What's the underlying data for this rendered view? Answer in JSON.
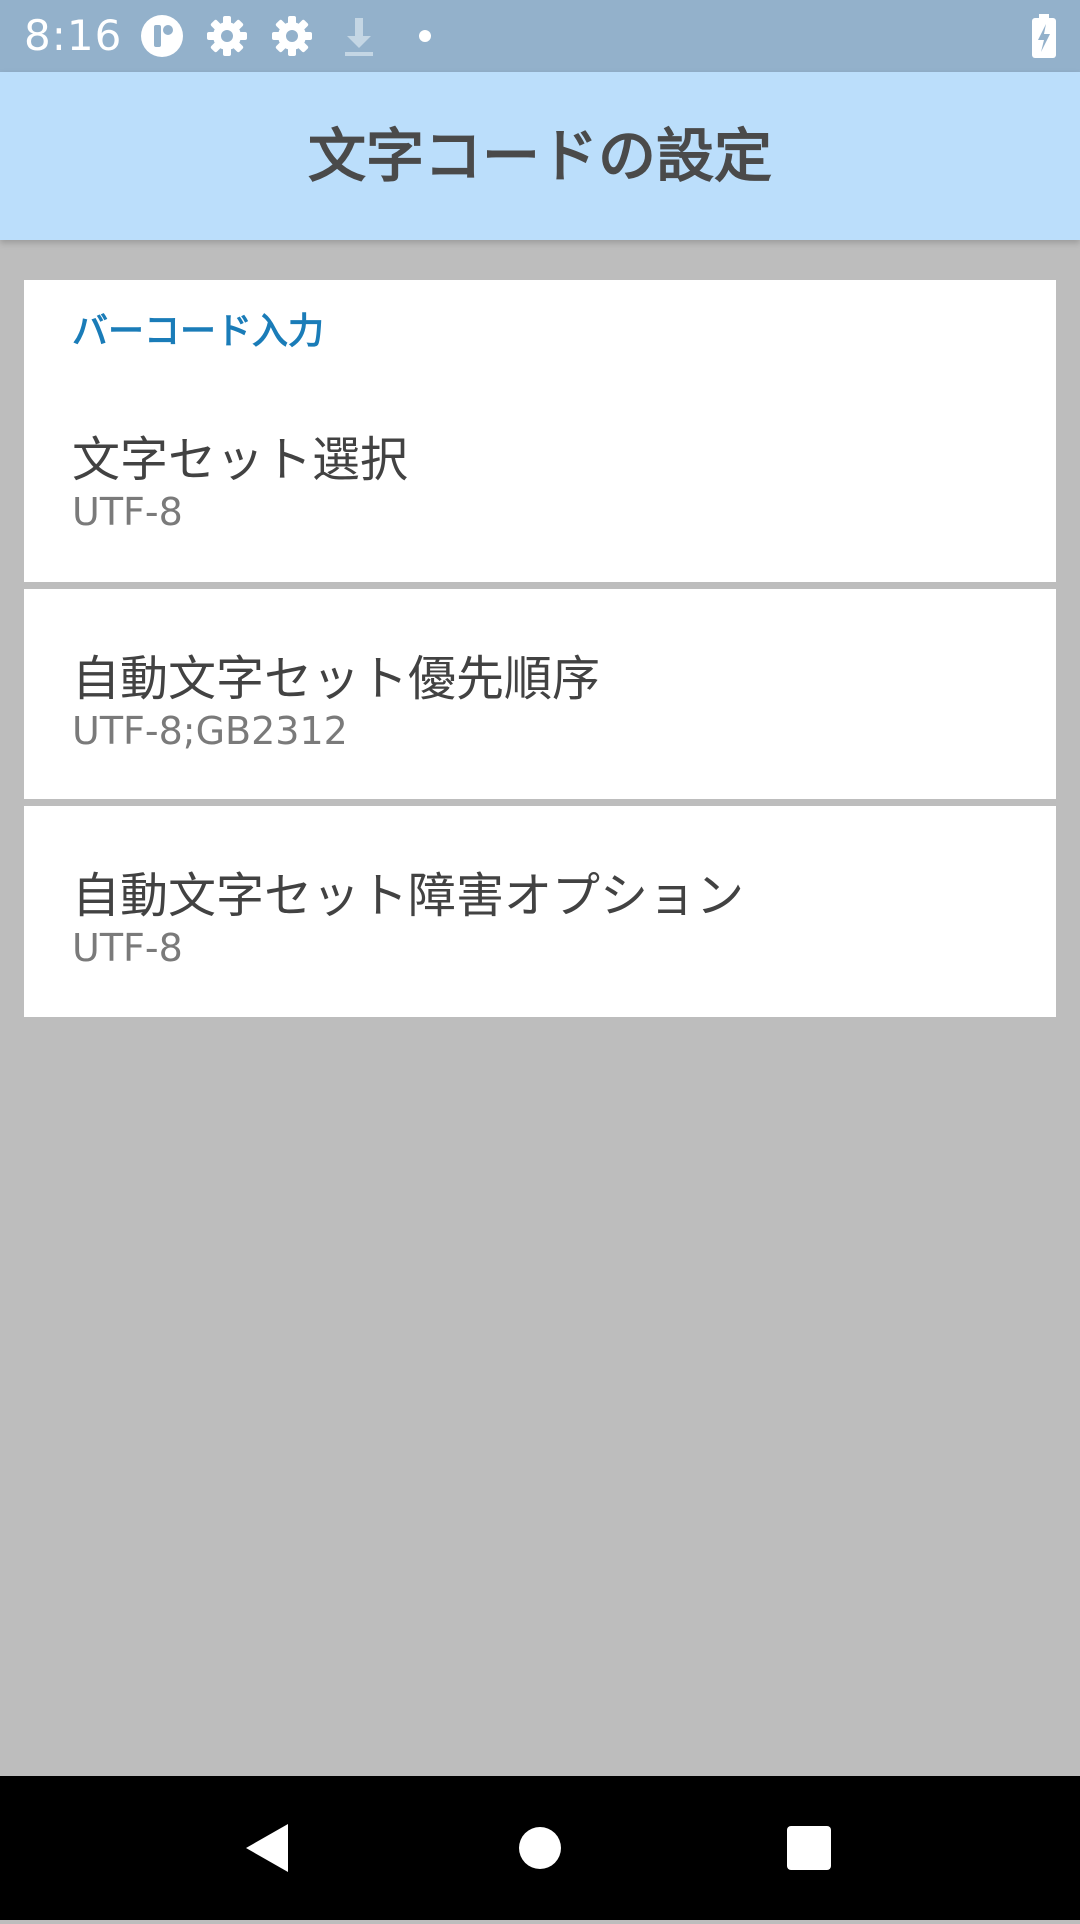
{
  "status_bar": {
    "time": "8:16",
    "icons": [
      "app-badge-icon",
      "gear-icon",
      "gear-icon",
      "download-icon",
      "dot-icon",
      "battery-charging-icon"
    ]
  },
  "header": {
    "title": "文字コードの設定"
  },
  "settings": {
    "section_header": "バーコード入力",
    "items": [
      {
        "title": "文字セット選択",
        "summary": "UTF-8"
      },
      {
        "title": "自動文字セット優先順序",
        "summary": "UTF-8;GB2312"
      },
      {
        "title": "自動文字セット障害オプション",
        "summary": "UTF-8"
      }
    ]
  },
  "nav_bar": {
    "buttons": [
      "back-icon",
      "home-icon",
      "recents-icon"
    ]
  },
  "colors": {
    "status_bar": "#93b1cb",
    "header": "#bbdefb",
    "section_header": "#1a7cb8",
    "background": "#bdbdbd"
  }
}
